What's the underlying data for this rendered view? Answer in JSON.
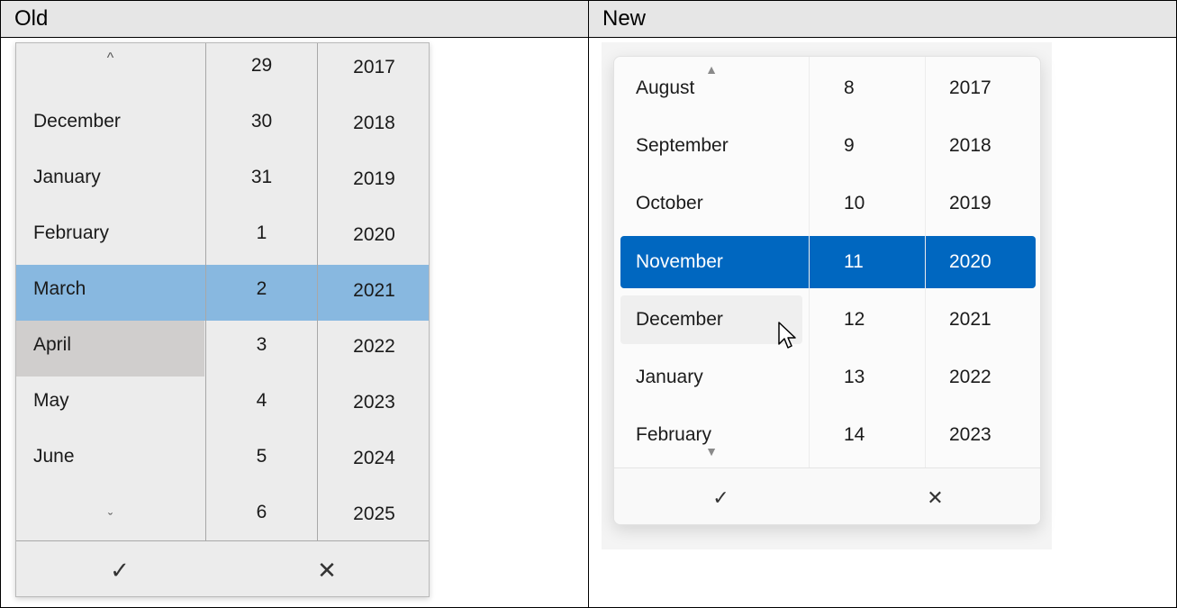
{
  "table": {
    "header_old": "Old",
    "header_new": "New"
  },
  "old_picker": {
    "months": [
      "",
      "December",
      "January",
      "February",
      "March",
      "April",
      "May",
      "June",
      ""
    ],
    "days": [
      "29",
      "30",
      "31",
      "1",
      "2",
      "3",
      "4",
      "5",
      "6"
    ],
    "years": [
      "2017",
      "2018",
      "2019",
      "2020",
      "2021",
      "2022",
      "2023",
      "2024",
      "2025"
    ],
    "selected_index": 4,
    "hovered_month": "April",
    "up_glyph": "^",
    "down_glyph": "ˇ",
    "accept_glyph": "✓",
    "dismiss_glyph": "✕",
    "selection_color": "#88b8e0"
  },
  "new_picker": {
    "months": [
      "August",
      "September",
      "October",
      "November",
      "December",
      "January",
      "February"
    ],
    "days": [
      "8",
      "9",
      "10",
      "11",
      "12",
      "13",
      "14"
    ],
    "years": [
      "2017",
      "2018",
      "2019",
      "2020",
      "2021",
      "2022",
      "2023"
    ],
    "selected_index": 3,
    "hovered_month": "December",
    "up_glyph": "▲",
    "down_glyph": "▼",
    "accept_glyph": "✓",
    "dismiss_glyph": "✕",
    "selection_color": "#0067c0"
  },
  "icons": {
    "cursor": "mouse-pointer-icon"
  }
}
